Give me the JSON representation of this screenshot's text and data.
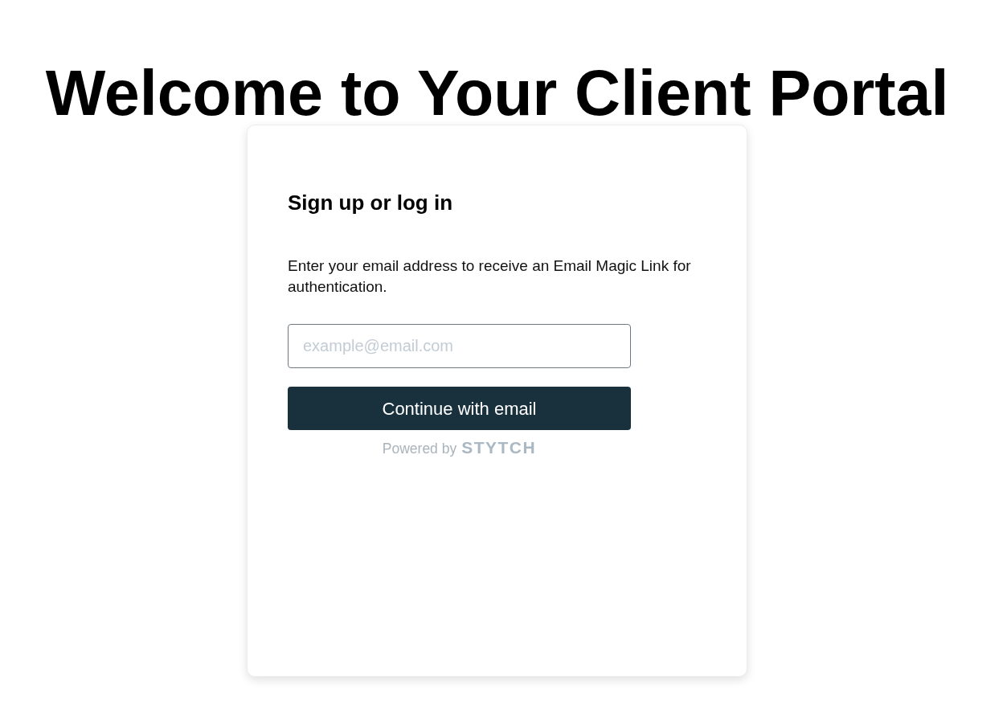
{
  "page": {
    "title": "Welcome to Your Client Portal"
  },
  "login_card": {
    "title": "Sign up or log in",
    "description": "Enter your email address to receive an Email Magic Link for authentication.",
    "email_field": {
      "placeholder": "example@email.com"
    },
    "submit_button": "Continue with email",
    "footer": {
      "prefix": "Powered by",
      "brand": "STYTCH"
    }
  }
}
